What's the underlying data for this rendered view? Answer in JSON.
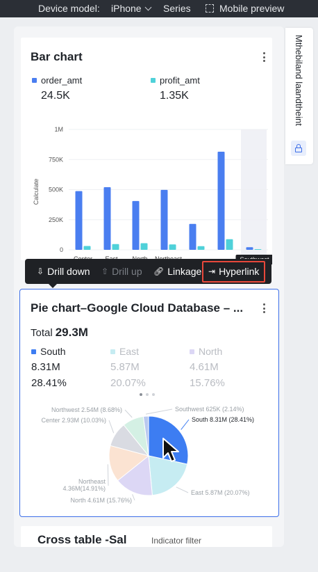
{
  "topbar": {
    "device_model_label": "Device model:",
    "device_model_value": "iPhone",
    "series_label": "Series",
    "mobile_preview_label": "Mobile preview"
  },
  "side_panel": {
    "text": "Mthebiland laandtheint"
  },
  "bar_card": {
    "title": "Bar chart",
    "legend": [
      {
        "name": "order_amt",
        "value": "24.5K",
        "color": "#4a7ef0"
      },
      {
        "name": "profit_amt",
        "value": "1.35K",
        "color": "#4fd1d9"
      }
    ],
    "tooltip_label": "Southwest"
  },
  "toolbar": {
    "drill_down": "Drill down",
    "drill_up": "Drill up",
    "linkage": "Linkage",
    "hyperlink": "Hyperlink"
  },
  "pie_card": {
    "title": "Pie chart–Google Cloud Database – ...",
    "total_label": "Total",
    "total_value": "29.3M",
    "legend": [
      {
        "name": "South",
        "value": "8.31M",
        "pct": "28.41%",
        "color": "#3d7df2"
      },
      {
        "name": "East",
        "value": "5.87M",
        "pct": "20.07%",
        "color": "#bde8ee"
      },
      {
        "name": "North",
        "value": "4.61M",
        "pct": "15.76%",
        "color": "#d4cff2"
      }
    ]
  },
  "cross_card": {
    "title": "Cross table -Sal",
    "filter": "Indicator filter"
  },
  "chart_data": [
    {
      "type": "bar",
      "title": "Bar chart",
      "ylabel": "Calculate",
      "xlabel": "",
      "categories": [
        "Center",
        "East",
        "North",
        "Northeast",
        "",
        "",
        "Southwest"
      ],
      "yticks": [
        "0",
        "250K",
        "500K",
        "750K",
        "1M"
      ],
      "ylim": [
        0,
        1000000
      ],
      "highlighted_category": "Southwest",
      "series": [
        {
          "name": "order_amt",
          "color": "#4a7ef0",
          "values": [
            488000,
            520000,
            405000,
            498000,
            215000,
            815000,
            22000
          ]
        },
        {
          "name": "profit_amt",
          "color": "#4fd1d9",
          "values": [
            32000,
            48000,
            55000,
            45000,
            30000,
            88000,
            6000
          ]
        }
      ]
    },
    {
      "type": "pie",
      "title": "Pie chart–Google Cloud Database – ...",
      "slices": [
        {
          "label": "South",
          "display": "South 8.31M (28.41%)",
          "value": 8.31,
          "color": "#3d7df2",
          "pct": 28.41
        },
        {
          "label": "East",
          "display": "East 5.87M (20.07%)",
          "value": 5.87,
          "color": "#c6ecf2",
          "pct": 20.07
        },
        {
          "label": "North",
          "display": "North 4.61M (15.76%)",
          "value": 4.61,
          "color": "#dcd7f5",
          "pct": 15.76
        },
        {
          "label": "Northeast",
          "display": "Northeast 4.36M(14.91%)",
          "value": 4.36,
          "color": "#fbe3d2",
          "pct": 14.91
        },
        {
          "label": "Center",
          "display": "Center 2.93M (10.03%)",
          "value": 2.93,
          "color": "#d9dbe2",
          "pct": 10.03
        },
        {
          "label": "Northwest",
          "display": "Northwest 2.54M (8.68%)",
          "value": 2.54,
          "color": "#d4f0e4",
          "pct": 8.68
        },
        {
          "label": "Southwest",
          "display": "Southwest 625K (2.14%)",
          "value": 0.625,
          "color": "#b9c9ef",
          "pct": 2.14
        }
      ]
    }
  ]
}
